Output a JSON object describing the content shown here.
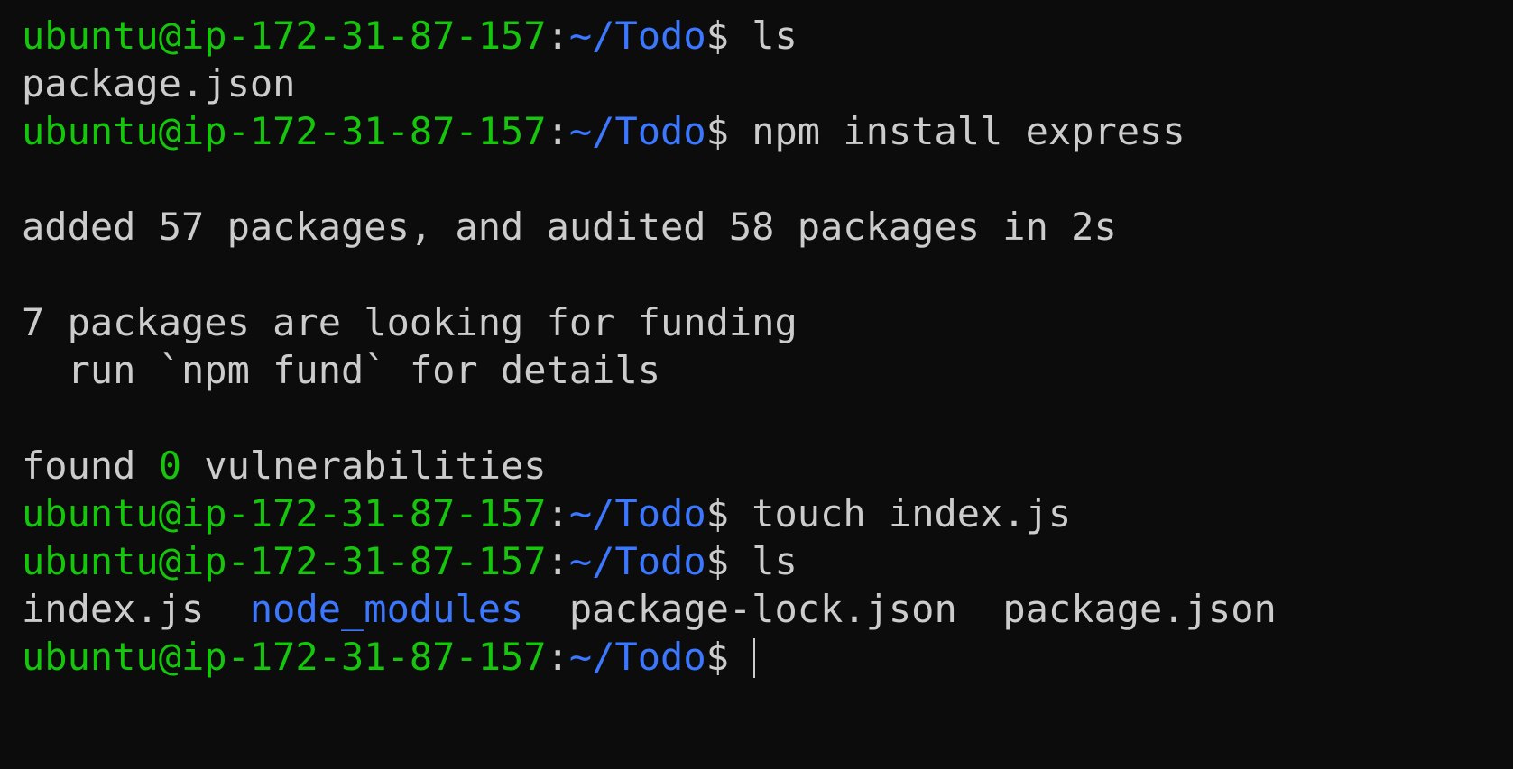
{
  "prompt": {
    "user_host": "ubuntu@ip-172-31-87-157",
    "colon": ":",
    "path": "~/Todo",
    "symbol": "$ "
  },
  "lines": {
    "cmd_ls_1": "ls",
    "out_package_json": "package.json",
    "cmd_npm_install": "npm install express",
    "out_added": "added 57 packages, and audited 58 packages in 2s",
    "out_funding": "7 packages are looking for funding",
    "out_fund_details": "  run `npm fund` for details",
    "out_found_prefix": "found ",
    "out_found_count": "0",
    "out_found_suffix": " vulnerabilities",
    "cmd_touch": "touch index.js",
    "cmd_ls_2": "ls"
  },
  "ls_output": {
    "item1": "index.js",
    "sep1": "  ",
    "item2": "node_modules",
    "sep2": "  ",
    "item3": "package-lock.json",
    "sep3": "  ",
    "item4": "package.json"
  },
  "colors": {
    "background": "#0c0c0c",
    "text": "#cccccc",
    "prompt_user": "#16c60c",
    "prompt_path": "#3b78ff",
    "directory": "#3b78ff",
    "zero_count": "#16c60c"
  }
}
